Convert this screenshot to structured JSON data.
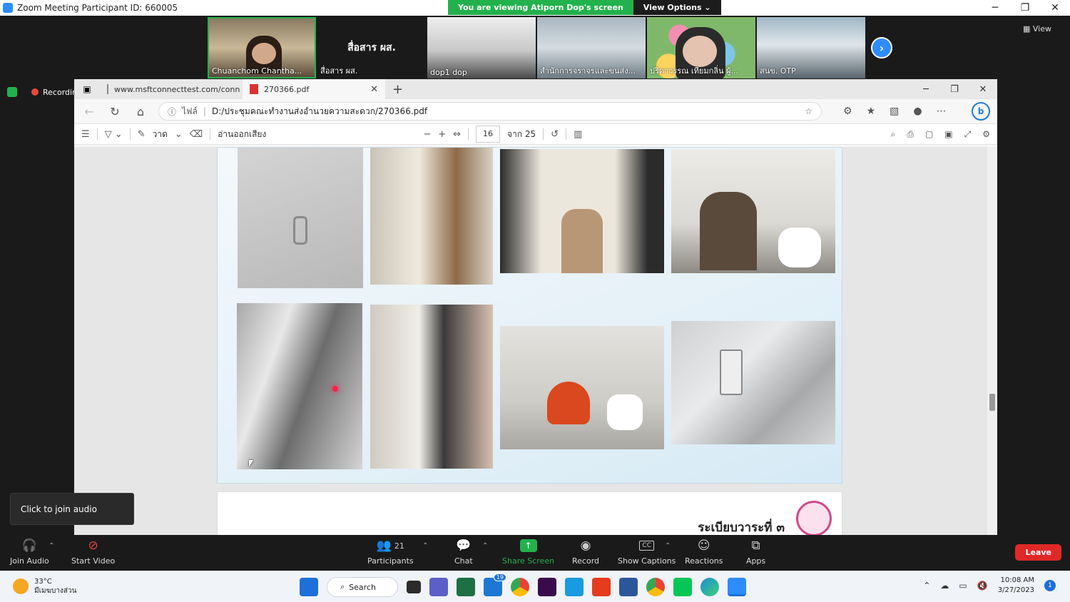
{
  "zoom": {
    "title": "Zoom Meeting Participant ID: 660005",
    "viewing": "You are viewing Atiporn Dop's screen",
    "view_options": "View Options",
    "view_label": "View",
    "recording": "Recording",
    "thumbnails": [
      {
        "name": "Chuanchom Chantha..."
      },
      {
        "name": "สื่อสาร ผส.",
        "big": "สื่อสาร ผส."
      },
      {
        "name": "dop1 dop"
      },
      {
        "name": "สำนักการจราจรและขนส่ง..."
      },
      {
        "name": "ปริดาวรรณ เทียมกลิ่น ผู้..."
      },
      {
        "name": "สนข. OTP"
      }
    ],
    "tooltip": "Click to join audio",
    "toolbar": {
      "join_audio": "Join Audio",
      "start_video": "Start Video",
      "participants": "Participants",
      "participant_count": "21",
      "chat": "Chat",
      "share_screen": "Share Screen",
      "record": "Record",
      "show_captions": "Show Captions",
      "cc": "CC",
      "reactions": "Reactions",
      "apps": "Apps",
      "leave": "Leave"
    }
  },
  "edge": {
    "tabs": [
      {
        "title": "www.msftconnecttest.com/conn"
      },
      {
        "title": "270366.pdf"
      }
    ],
    "address": {
      "file_label": "ไฟล์",
      "path": "D:/ประชุมคณะทำงานส่งอำนวยความสะดวก/270366.pdf"
    },
    "pdf_toolbar": {
      "draw": "วาด",
      "read_aloud": "อ่านออกเสียง",
      "page_current": "16",
      "page_total": "จาก 25"
    },
    "page2_title": "ระเบียบวาระที่ ๓"
  },
  "taskbar": {
    "temp": "33°C",
    "weather_desc": "มีเมฆบางส่วน",
    "search": "Search",
    "mail_badge": "19",
    "time": "10:08 AM",
    "date": "3/27/2023",
    "notif_count": "1"
  }
}
